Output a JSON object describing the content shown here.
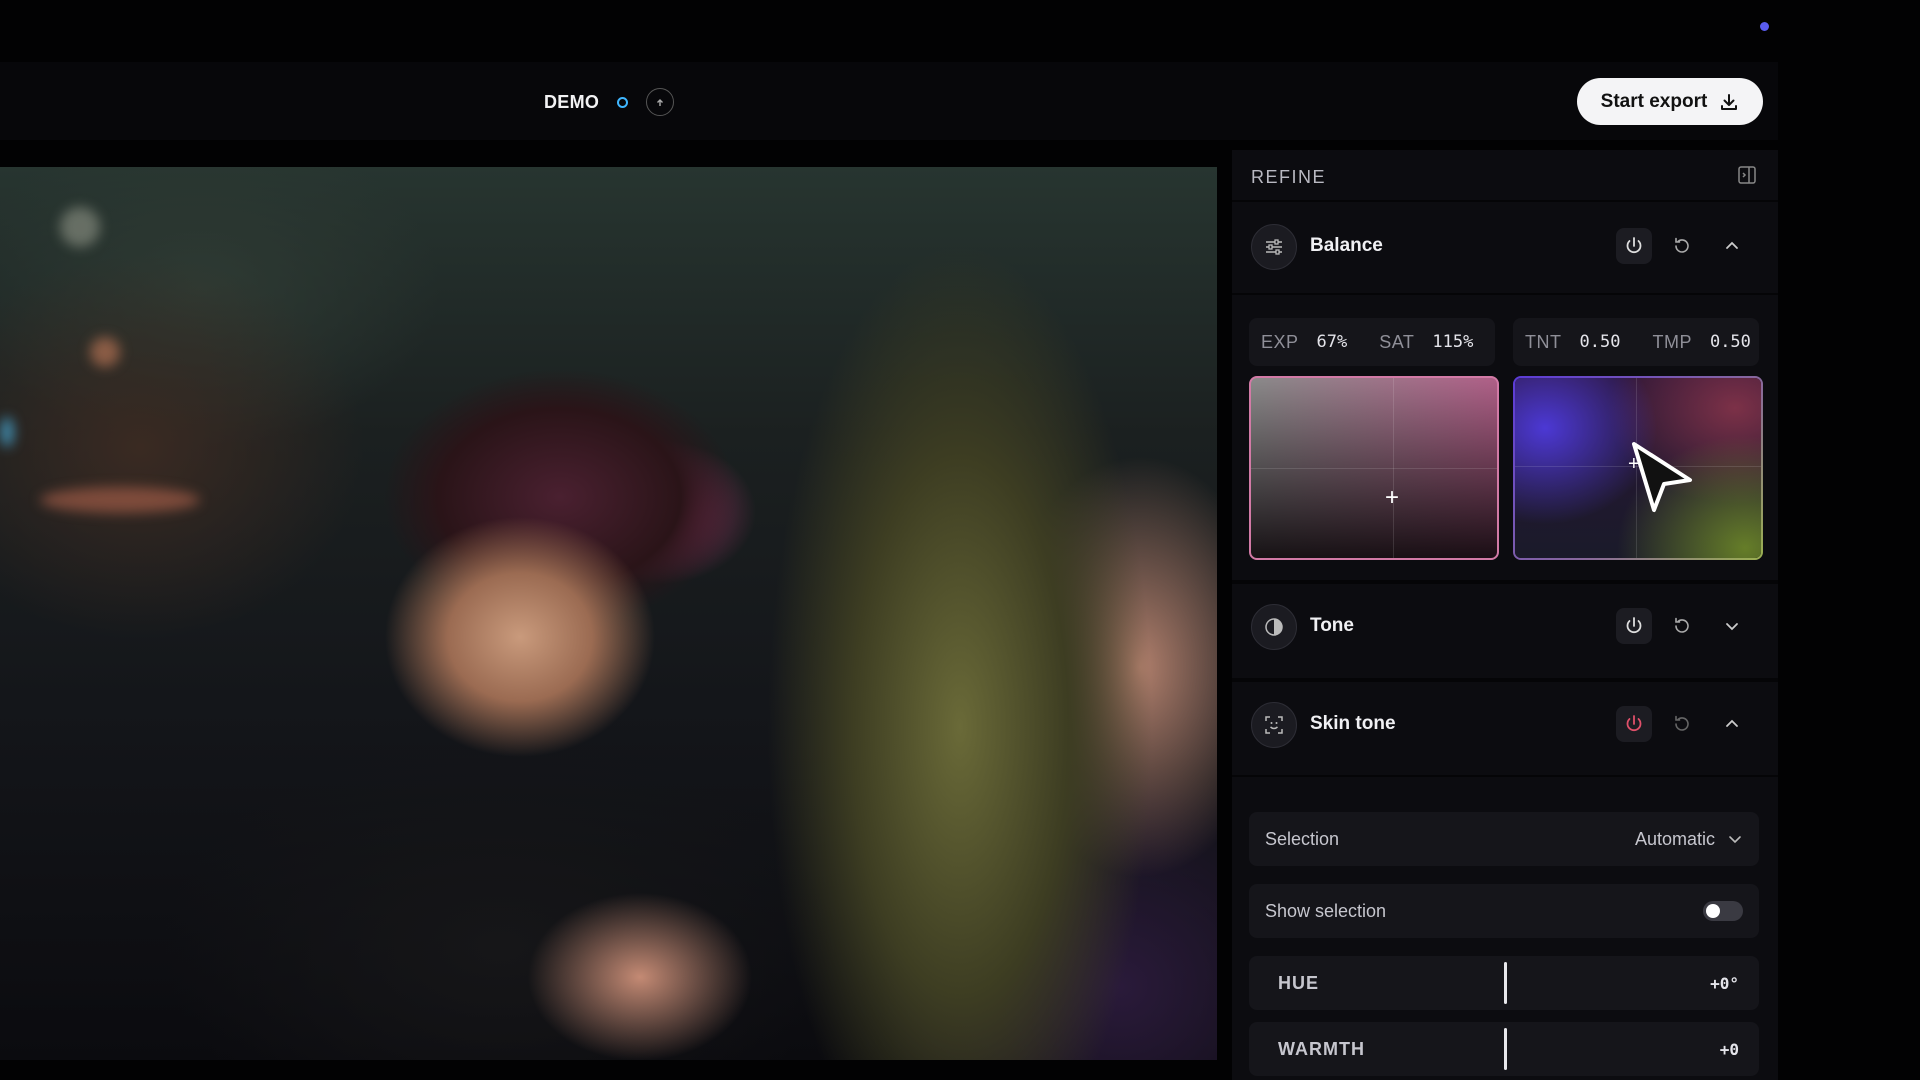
{
  "project": {
    "name": "DEMO"
  },
  "toolbar": {
    "export_label": "Start export"
  },
  "panel": {
    "title": "REFINE",
    "balance": {
      "title": "Balance",
      "readouts": [
        {
          "label": "EXP",
          "value": "67%"
        },
        {
          "label": "SAT",
          "value": "115%"
        },
        {
          "label": "TNT",
          "value": "0.50"
        },
        {
          "label": "TMP",
          "value": "0.50"
        }
      ]
    },
    "tone": {
      "title": "Tone"
    },
    "skin_tone": {
      "title": "Skin tone",
      "selection_label": "Selection",
      "selection_value": "Automatic",
      "show_selection_label": "Show selection",
      "show_selection_on": false,
      "sliders": [
        {
          "label": "HUE",
          "value": "+0°"
        },
        {
          "label": "WARMTH",
          "value": "+0"
        }
      ]
    }
  },
  "icons": [
    "sync-icon",
    "download-icon",
    "panel-collapse-icon",
    "sliders-icon",
    "power-icon",
    "reset-icon",
    "chevron-up-icon",
    "chevron-down-icon",
    "tone-icon",
    "face-icon",
    "plus-icon",
    "cursor-icon"
  ],
  "colors": {
    "accent": "#5a5cf0",
    "power_active": "#e0506a",
    "live": "#3fb6ff"
  }
}
